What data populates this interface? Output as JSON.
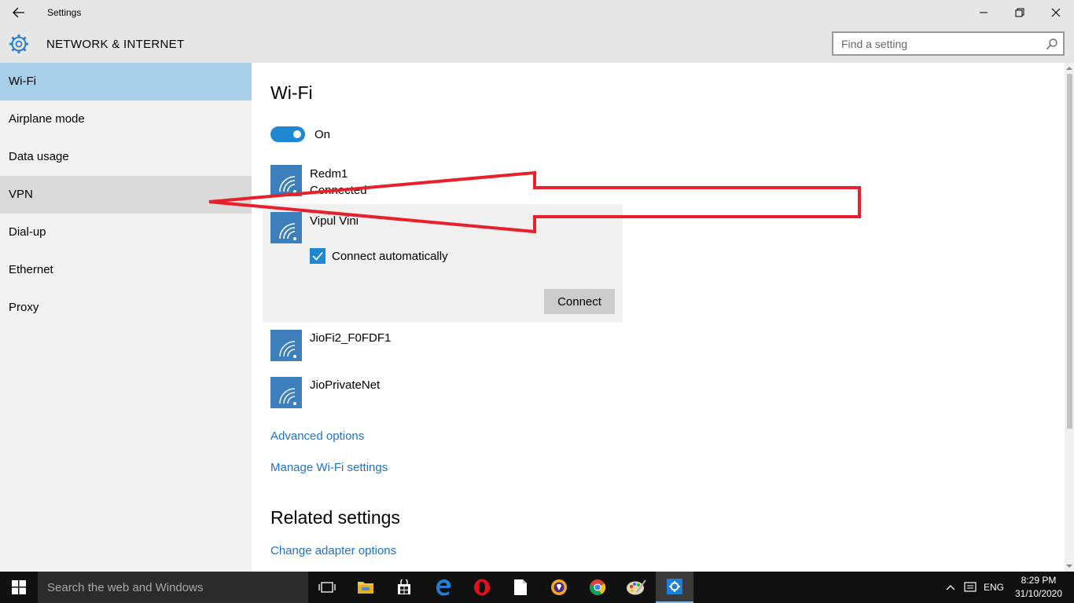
{
  "window": {
    "title": "Settings",
    "page_heading": "NETWORK & INTERNET"
  },
  "search": {
    "placeholder": "Find a setting"
  },
  "sidebar": {
    "items": [
      {
        "label": "Wi-Fi",
        "state": "selected"
      },
      {
        "label": "Airplane mode"
      },
      {
        "label": "Data usage"
      },
      {
        "label": "VPN",
        "state": "hover"
      },
      {
        "label": "Dial-up"
      },
      {
        "label": "Ethernet"
      },
      {
        "label": "Proxy"
      }
    ]
  },
  "main": {
    "title": "Wi-Fi",
    "toggle_label": "On",
    "networks": [
      {
        "name": "Redm1",
        "status": "Connected"
      },
      {
        "name": "Vipul Vini",
        "connect_automatically": "Connect automatically",
        "button": "Connect"
      },
      {
        "name": "JioFi2_F0FDF1"
      },
      {
        "name": "JioPrivateNet"
      }
    ],
    "advanced_options": "Advanced options",
    "manage_wifi": "Manage Wi-Fi settings",
    "related_title": "Related settings",
    "change_adapter": "Change adapter options"
  },
  "taskbar": {
    "search_text": "Search the web and Windows",
    "language": "ENG",
    "time": "8:29 PM",
    "date": "31/10/2020",
    "icons": [
      "task-view-icon",
      "file-explorer-icon",
      "store-icon",
      "edge-icon",
      "opera-icon",
      "notepad-icon",
      "brave-icon",
      "chrome-icon",
      "paint-icon",
      "settings-icon"
    ]
  },
  "colors": {
    "accent": "#1e88d2",
    "selected_nav": "#a8cfe8",
    "link": "#1a73c8",
    "annotation_arrow": "#e8202a"
  }
}
